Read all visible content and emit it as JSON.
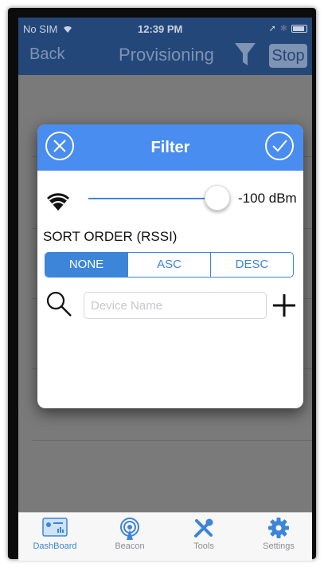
{
  "status_bar": {
    "carrier": "No SIM",
    "time": "12:39 PM"
  },
  "nav": {
    "back_label": "Back",
    "title": "Provisioning",
    "stop_label": "Stop"
  },
  "filter_dialog": {
    "title": "Filter",
    "rssi": {
      "value": -100,
      "value_label": "-100 dBm"
    },
    "sort_order_label": "SORT ORDER (RSSI)",
    "sort_options": [
      "NONE",
      "ASC",
      "DESC"
    ],
    "sort_selected": "NONE",
    "device_name": {
      "value": "",
      "placeholder": "Device Name"
    }
  },
  "tab_bar": {
    "items": [
      {
        "label": "DashBoard",
        "icon": "dashboard-icon",
        "active": true
      },
      {
        "label": "Beacon",
        "icon": "beacon-icon",
        "active": false
      },
      {
        "label": "Tools",
        "icon": "tools-icon",
        "active": false
      },
      {
        "label": "Settings",
        "icon": "gear-icon",
        "active": false
      }
    ]
  },
  "colors": {
    "accent": "#4a8df0",
    "nav_dimmed": "#24477a",
    "segment": "#3d85d8",
    "tab_active": "#3d85d8",
    "tab_inactive": "#8e8e93"
  }
}
